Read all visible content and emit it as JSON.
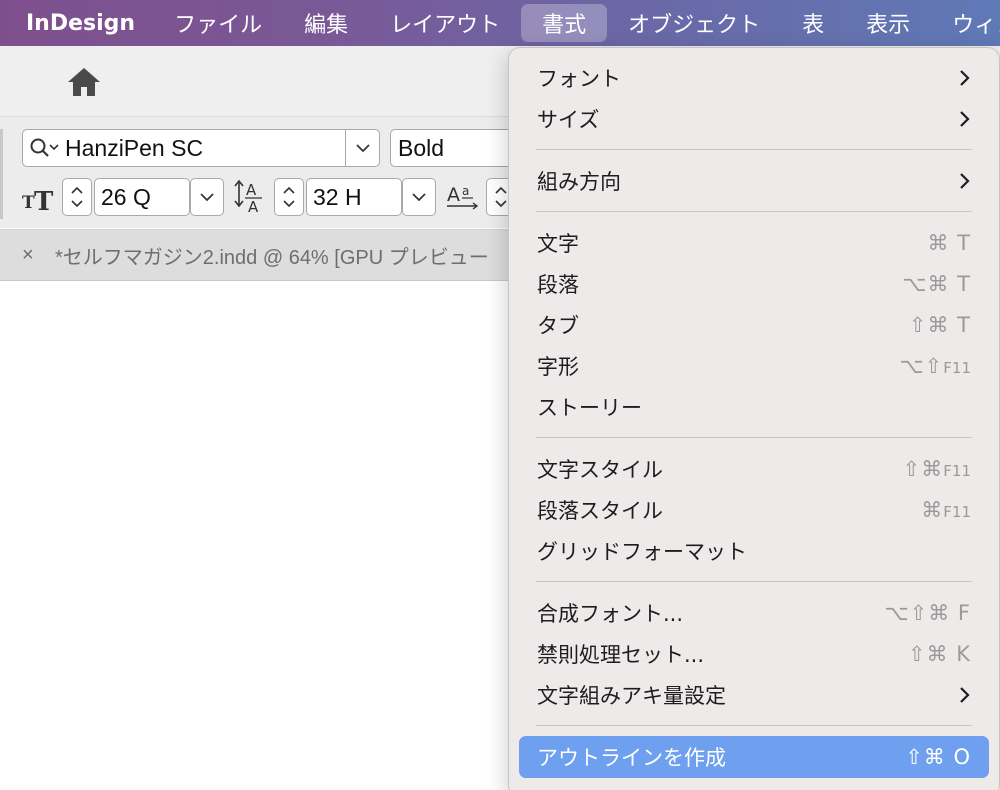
{
  "menubar": {
    "app_name": "InDesign",
    "items": [
      "ファイル",
      "編集",
      "レイアウト",
      "書式",
      "オブジェクト",
      "表",
      "表示",
      "ウィン"
    ],
    "active": "書式"
  },
  "control_bar": {
    "font_family": "HanziPen SC",
    "font_style": "Bold",
    "font_size": "26 Q",
    "leading": "32 H"
  },
  "document_tab": {
    "close_glyph": "×",
    "title": "*セルフマガジン2.indd @ 64% [GPU プレビュー"
  },
  "type_menu": {
    "items": [
      {
        "label": "フォント",
        "submenu": true
      },
      {
        "label": "サイズ",
        "submenu": true
      },
      {
        "label": "組み方向",
        "submenu": true
      },
      {
        "label": "文字",
        "shortcut": "⌘ T"
      },
      {
        "label": "段落",
        "shortcut": "⌥⌘ T"
      },
      {
        "label": "タブ",
        "shortcut": "⇧⌘ T"
      },
      {
        "label": "字形",
        "shortcut_mods": "⌥⇧",
        "shortcut_key": "F11"
      },
      {
        "label": "ストーリー"
      },
      {
        "label": "文字スタイル",
        "shortcut_mods": "⇧⌘",
        "shortcut_key": "F11"
      },
      {
        "label": "段落スタイル",
        "shortcut_mods": "⌘",
        "shortcut_key": "F11"
      },
      {
        "label": "グリッドフォーマット"
      },
      {
        "label": "合成フォント...",
        "shortcut": "⌥⇧⌘ F"
      },
      {
        "label": "禁則処理セット...",
        "shortcut": "⇧⌘ K"
      },
      {
        "label": "文字組みアキ量設定",
        "submenu": true
      },
      {
        "label": "アウトラインを作成",
        "shortcut": "⇧⌘ O",
        "highlighted": true
      }
    ],
    "highlight_color": "#6fa0f0"
  }
}
